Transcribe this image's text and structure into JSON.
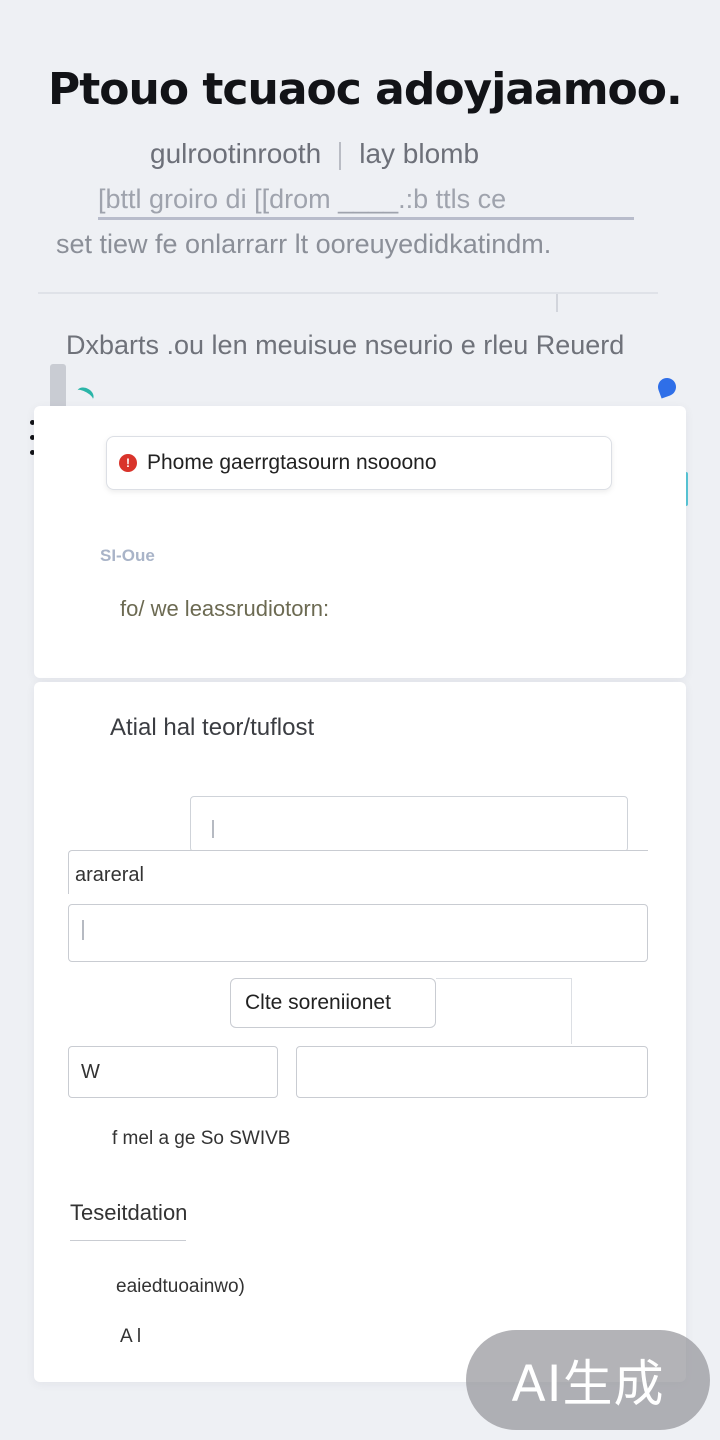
{
  "header": {
    "title": "Ptouo tcuaoc adoyjaamoo.",
    "subtitle_left": "gulrootinrooth",
    "subtitle_right": "lay blomb",
    "link_line": "[bttl groiro di [[drom ____.:b ttls ce",
    "description": "set tiew fe onlarrarr lt ooreuyedidkatindm.",
    "reward_line": "Dxbarts .ou len meuisue nseurio e rleu Reuerd"
  },
  "alert_card": {
    "alert_icon": "alert-icon",
    "alert_text": "Phome gaerrgtasourn nsooono",
    "label": "SI-Oue",
    "text": "fo/ we leassrudiotorn:"
  },
  "form_card": {
    "title": "Atial hal teor/tuflost",
    "field_top_value": "",
    "arateral_label": "arareral",
    "field_wide_value": "",
    "cite_button": "Clte soreniionet",
    "field_w_value": "W",
    "field_right_value": "",
    "fine_text": "f mel a ge So SWIVB",
    "section_label": "Teseitdation",
    "extended_text": "eaiedtuoainwo)",
    "ai_text": "A l"
  },
  "colors": {
    "accent_blue": "#2f6fe8",
    "accent_teal": "#2bb5a8",
    "alert_red": "#d9342b",
    "background": "#eef0f4"
  },
  "watermark": "AI生成"
}
